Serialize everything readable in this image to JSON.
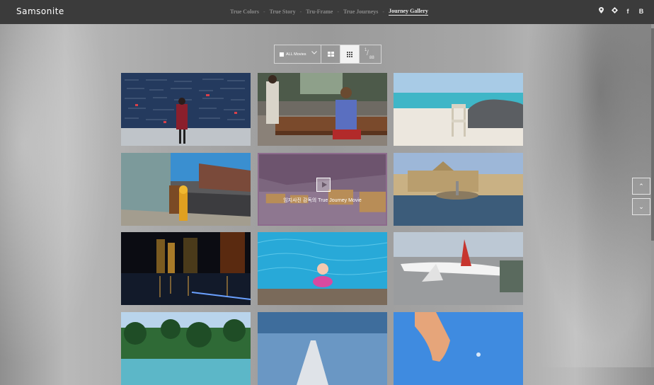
{
  "brand": {
    "logo": "Samsonite"
  },
  "nav": {
    "items": [
      "True Colors",
      "True Story",
      "Tru-Frame",
      "True Journeys",
      "Journey Gallery"
    ],
    "separator": "-",
    "active": "Journey Gallery"
  },
  "social": [
    "location-icon",
    "instagram-icon",
    "f",
    "B"
  ],
  "toolbar": {
    "filter_label": "ALL Movies",
    "page_current": "1",
    "page_total": "88"
  },
  "gallery": {
    "featured_caption": "임지사진 감독의 True Journey Movie",
    "tiles": [
      "love-wall-photo",
      "cafe-bench-photo",
      "beach-chair-photo",
      "street-hydrant-photo",
      "taxi-video-tile",
      "fountain-square-photo",
      "night-city-photo",
      "pool-girl-photo",
      "airplane-photo",
      "palm-resort-photo",
      "wing-sky-photo",
      "hand-sky-photo"
    ]
  },
  "side": {
    "up": "⌃",
    "down": "⌄"
  },
  "colors": {
    "header": "#3b3b3b",
    "active_nav": "#e8e8e8",
    "inactive_nav": "#8a8a8a"
  }
}
